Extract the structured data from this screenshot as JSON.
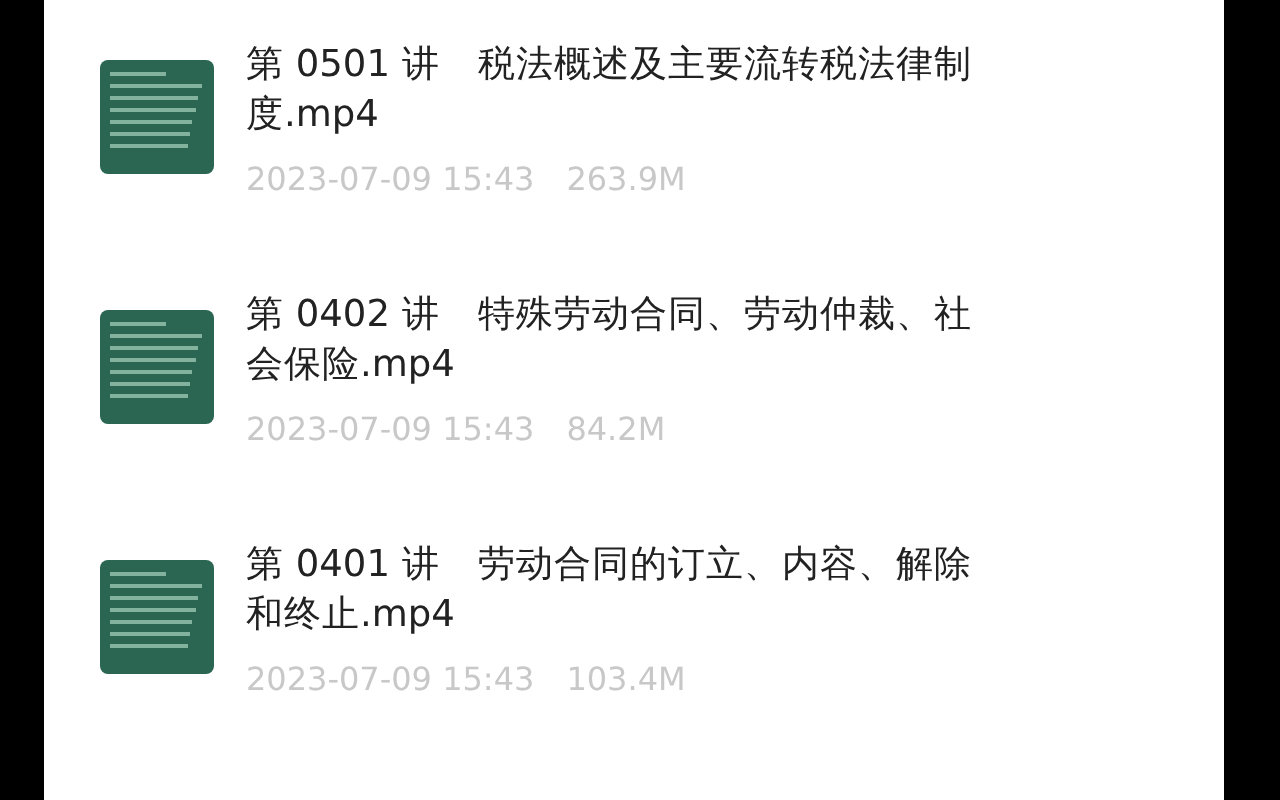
{
  "files": [
    {
      "title": "第 0501 讲　税法概述及主要流转税法律制度.mp4",
      "date": "2023-07-09 15:43",
      "size": "263.9M"
    },
    {
      "title": "第 0402 讲　特殊劳动合同、劳动仲裁、社会保险.mp4",
      "date": "2023-07-09 15:43",
      "size": "84.2M"
    },
    {
      "title": "第 0401 讲　劳动合同的订立、内容、解除和终止.mp4",
      "date": "2023-07-09 15:43",
      "size": "103.4M"
    }
  ]
}
